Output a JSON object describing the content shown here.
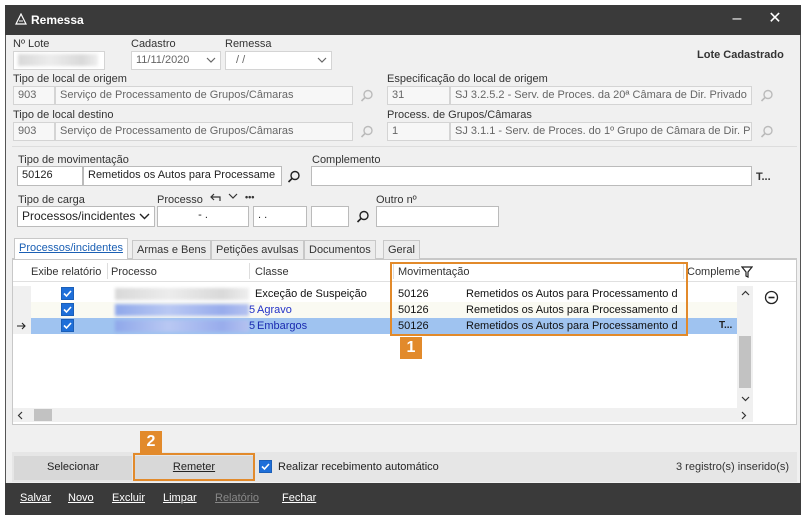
{
  "window": {
    "title": "Remessa"
  },
  "header": {
    "lote_label": "Nº Lote",
    "cadastro_label": "Cadastro",
    "cadastro_value": "11/11/2020",
    "remessa_label": "Remessa",
    "remessa_value": "/ /",
    "status": "Lote Cadastrado"
  },
  "origem": {
    "tipo_label": "Tipo de local de origem",
    "tipo_code": "903",
    "tipo_name": "Serviço de Processamento de Grupos/Câmaras",
    "especificacao_label": "Especificação do local de origem",
    "especificacao_code": "31",
    "especificacao_name": "SJ 3.2.5.2 - Serv. de Proces. da 20ª Câmara de Dir. Privado"
  },
  "destino": {
    "tipo_label": "Tipo de local destino",
    "tipo_code": "903",
    "tipo_name": "Serviço de Processamento de Grupos/Câmaras",
    "process_label": "Process. de Grupos/Câmaras",
    "process_code": "1",
    "process_name": "SJ 3.1.1 - Serv. de Proces. do 1º Grupo de Câmara de Dir. Pr"
  },
  "movimentacao": {
    "label": "Tipo de movimentação",
    "code": "50126",
    "name": "Remetidos os Autos para Processame",
    "complemento_label": "Complemento",
    "complemento_btn": "T...",
    "carga_label": "Tipo de carga",
    "carga_value": "Processos/incidentes",
    "processo_label": "Processo",
    "processo_part1": "- .",
    "processo_part2": ". .",
    "outro_label": "Outro nº",
    "more_btn": "•••"
  },
  "tabs": [
    {
      "label": "Processos/incidentes"
    },
    {
      "label": "Armas e Bens"
    },
    {
      "label": "Petições avulsas"
    },
    {
      "label": "Documentos"
    },
    {
      "label": "Geral"
    }
  ],
  "grid": {
    "columns": {
      "exibe": "Exibe relatório",
      "processo": "Processo",
      "classe": "Classe",
      "movimentacao": "Movimentação",
      "complemento": "Compleme"
    },
    "rows": [
      {
        "classe": "Exceção de Suspeição",
        "classe_prefix": "",
        "code": "50126",
        "desc": "Remetidos os Autos para Processamento d",
        "checked": true
      },
      {
        "classe": "Agravo",
        "classe_prefix": "5",
        "code": "50126",
        "desc": "Remetidos os Autos para Processamento d",
        "checked": true
      },
      {
        "classe": "Embargos",
        "classe_prefix": "5",
        "code": "50126",
        "desc": "Remetidos os Autos para Processamento d",
        "checked": true
      }
    ],
    "row_btn": "T..."
  },
  "callouts": {
    "one": "1",
    "two": "2"
  },
  "actions": {
    "selecionar": "Selecionar",
    "remeter": "Remeter",
    "auto_receipt": "Realizar recebimento automático",
    "count": "3 registro(s) inserido(s)"
  },
  "footer": {
    "salvar": "Salvar",
    "novo": "Novo",
    "excluir": "Excluir",
    "limpar": "Limpar",
    "relatorio": "Relatório",
    "fechar": "Fechar"
  },
  "colors": {
    "accent": "#1e6fd9",
    "callout": "#e28a2b",
    "titlebar": "#3a3a3a"
  }
}
